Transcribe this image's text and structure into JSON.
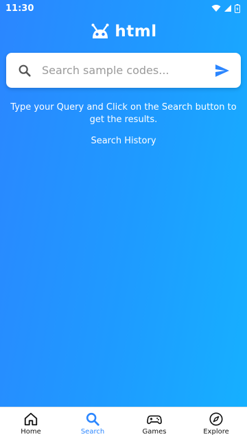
{
  "status_bar": {
    "time": "11:30"
  },
  "brand": {
    "name": "html",
    "logo_icon": "android-robot-icon"
  },
  "search": {
    "placeholder": "Search sample codes...",
    "value": "",
    "search_icon": "search-icon",
    "send_icon": "send-icon"
  },
  "main": {
    "hint": "Type your Query and Click on the Search button to get the results.",
    "history_link": "Search History"
  },
  "bottom_nav": {
    "items": [
      {
        "label": "Home",
        "icon": "home-icon",
        "active": false
      },
      {
        "label": "Search",
        "icon": "search-icon",
        "active": true
      },
      {
        "label": "Games",
        "icon": "gamepad-icon",
        "active": false
      },
      {
        "label": "Explore",
        "icon": "compass-icon",
        "active": false
      }
    ]
  },
  "colors": {
    "background_start": "#2b86ff",
    "background_end": "#16b0ff",
    "accent": "#2b86ff",
    "white": "#ffffff"
  }
}
